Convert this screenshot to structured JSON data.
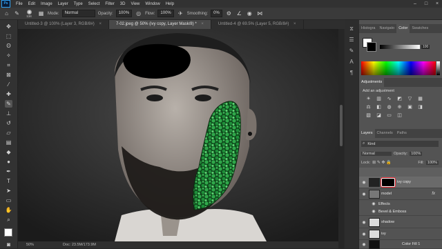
{
  "menubar": {
    "logo": "Ps",
    "items": [
      "File",
      "Edit",
      "Image",
      "Layer",
      "Type",
      "Select",
      "Filter",
      "3D",
      "View",
      "Window",
      "Help"
    ]
  },
  "options": {
    "brush_size": "134",
    "mode_label": "Mode:",
    "mode_value": "Normal",
    "opacity_label": "Opacity:",
    "opacity_value": "100%",
    "flow_label": "Flow:",
    "flow_value": "100%",
    "smoothing_label": "Smoothing:",
    "smoothing_value": "0%"
  },
  "tabs": [
    {
      "label": "Untitled-3 @ 100% (Layer 3, RGB/8#)",
      "close": "×"
    },
    {
      "label": "7-02.jpeg @ 50% (ivy copy, Layer Mask/8) *",
      "close": "×"
    },
    {
      "label": "Untitled-4 @ 69.5% (Layer 5, RGB/8#)",
      "close": "×"
    }
  ],
  "status": {
    "zoom": "50%",
    "doc": "Doc: 23.5M/173.9M"
  },
  "panels": {
    "top_tabs": [
      "Histogra",
      "Navigato",
      "Color",
      "Swatches"
    ],
    "color_value": "100",
    "adjustments_title": "Adjustments",
    "add_adjustment": "Add an adjustment",
    "layers_tabs": [
      "Layers",
      "Channels",
      "Paths"
    ],
    "kind_label": "Kind",
    "blend_mode": "Normal",
    "opacity_label": "Opacity:",
    "opacity_value": "100%",
    "lock_label": "Lock:",
    "fill_label": "Fill:",
    "fill_value": "100%",
    "layers": [
      {
        "name": "ivy copy"
      },
      {
        "name": "model",
        "fx": "fx"
      },
      {
        "name": "Effects"
      },
      {
        "name": "Bevel & Emboss"
      },
      {
        "name": "shadow"
      },
      {
        "name": "ivy"
      },
      {
        "name": "Color Fill 1"
      }
    ]
  },
  "colors": {
    "accent": "#2fa3f7",
    "ivy": "#1f8f3a",
    "annotation_red": "#e0202a"
  }
}
